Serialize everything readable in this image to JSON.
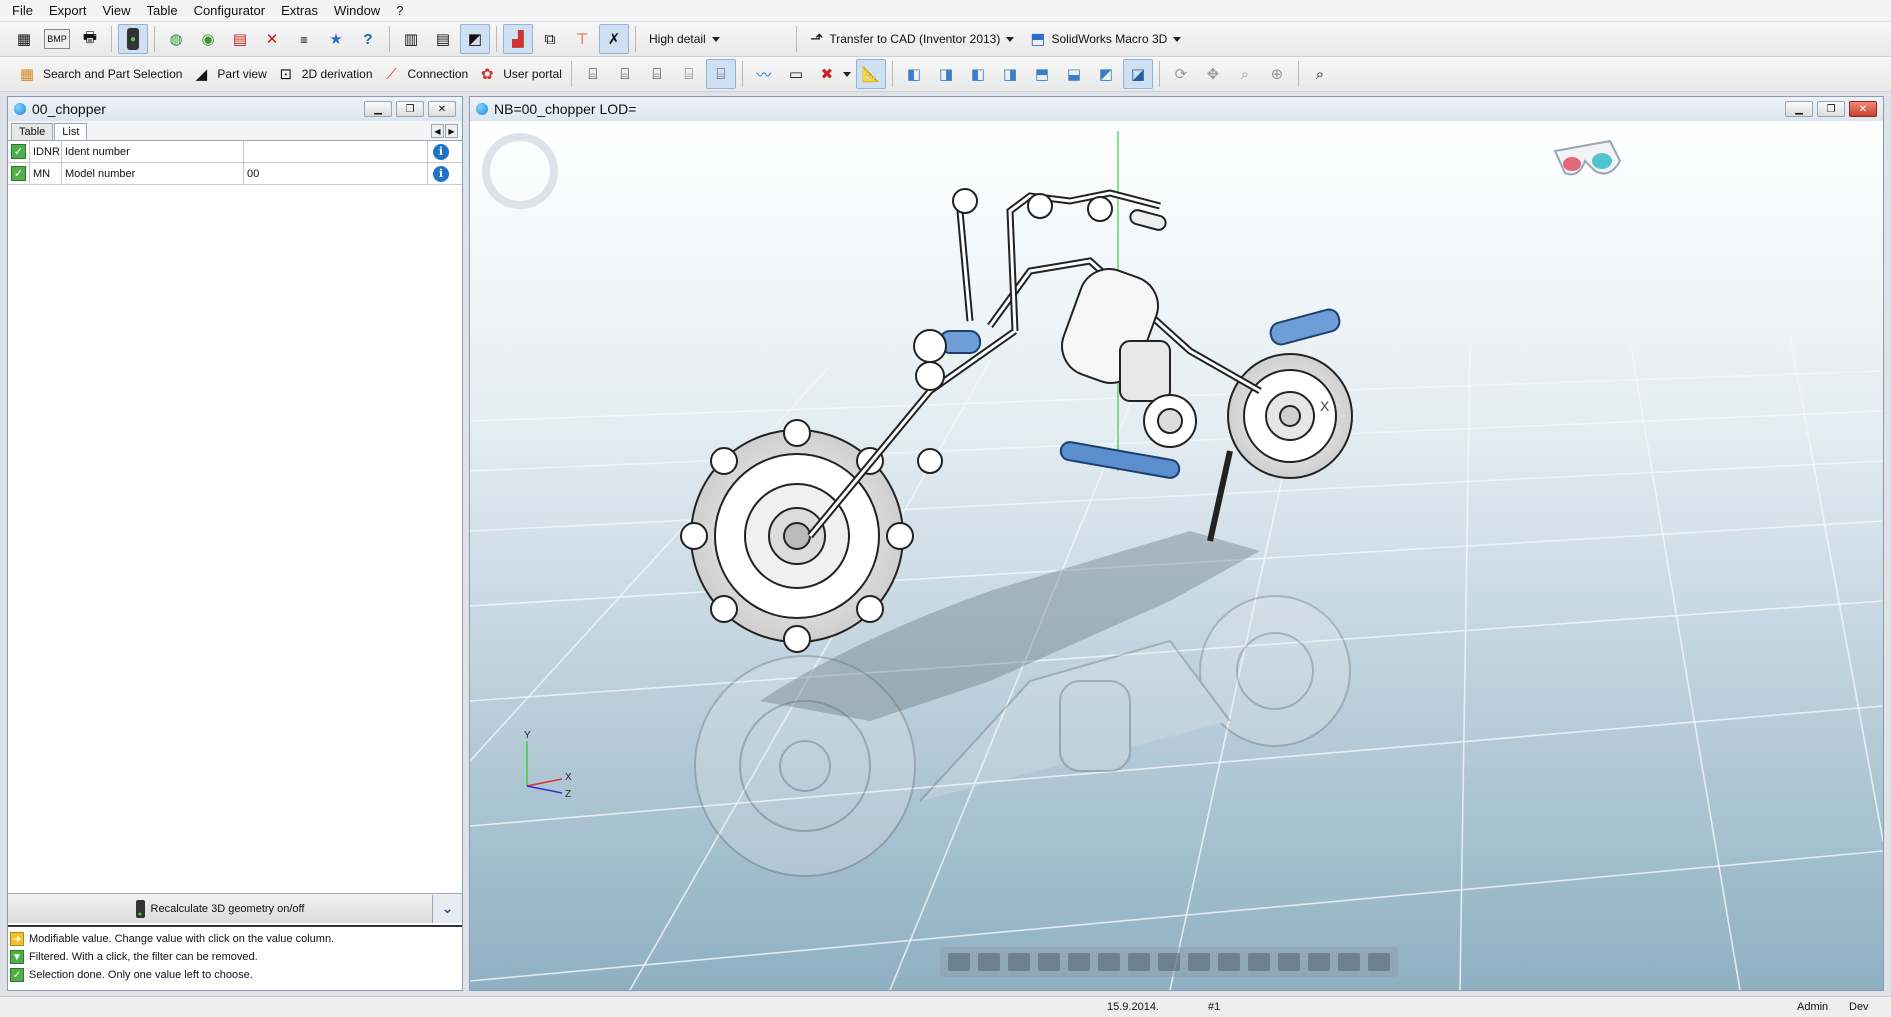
{
  "menu": [
    "File",
    "Export",
    "View",
    "Table",
    "Configurator",
    "Extras",
    "Window",
    "?"
  ],
  "toolbar1": {
    "detail_label": "High detail",
    "cad_label": "Transfer to CAD (Inventor 2013)",
    "macro_label": "SolidWorks Macro 3D",
    "bmp_label": "BMP"
  },
  "toolbar2": {
    "search_label": "Search and Part Selection",
    "partview_label": "Part view",
    "derivation_label": "2D derivation",
    "connection_label": "Connection",
    "portal_label": "User portal"
  },
  "left_panel": {
    "title": "00_chopper",
    "tabs": [
      "Table",
      "List"
    ],
    "rows": [
      {
        "code": "IDNR",
        "desc": "Ident number",
        "value": ""
      },
      {
        "code": "MN",
        "desc": "Model number",
        "value": "00"
      }
    ],
    "recalc_label": "Recalculate 3D geometry on/off",
    "legend": [
      {
        "icon": "arrow-icon",
        "color": "#f2c12e",
        "text": "Modifiable value. Change value with click on the value column."
      },
      {
        "icon": "filter-icon",
        "color": "#4fb04a",
        "text": "Filtered. With a click, the filter can be removed."
      },
      {
        "icon": "check-icon",
        "color": "#4fb04a",
        "text": "Selection done. Only one value left to choose."
      }
    ]
  },
  "viewport": {
    "title": "NB=00_chopper LOD=",
    "axis_y": "Y",
    "axis_x": "X",
    "axis_z": "Z",
    "marker_x": "X"
  },
  "status": {
    "date": "15.9.2014.",
    "number": "#1",
    "user": "Admin",
    "mode": "Dev"
  },
  "colors": {
    "accent": "#1b86d9",
    "scene_top": "#ffffff",
    "scene_bottom": "#8fb0c2"
  }
}
